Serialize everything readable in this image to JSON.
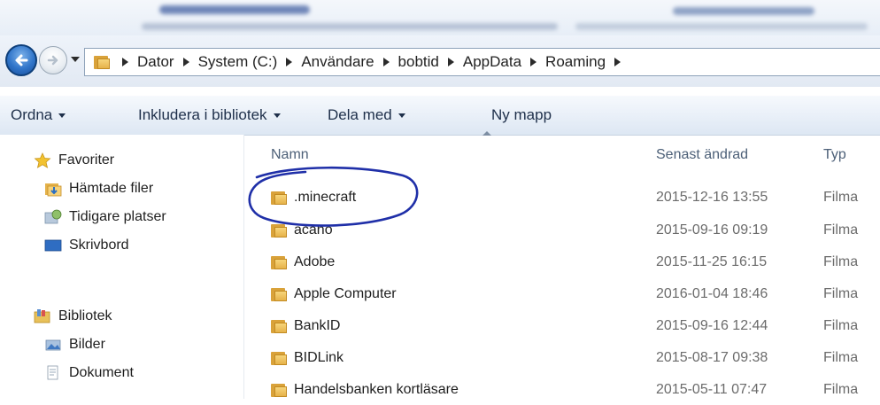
{
  "address": {
    "crumbs": [
      "Dator",
      "System (C:)",
      "Användare",
      "bobtid",
      "AppData",
      "Roaming"
    ]
  },
  "toolbar": {
    "organize": "Ordna",
    "include_in_library": "Inkludera i bibliotek",
    "share_with": "Dela med",
    "new_folder": "Ny mapp"
  },
  "navpane": {
    "favorites": "Favoriter",
    "downloads": "Hämtade filer",
    "recent_places": "Tidigare platser",
    "desktop": "Skrivbord",
    "libraries": "Bibliotek",
    "pictures": "Bilder",
    "documents": "Dokument"
  },
  "columns": {
    "name": "Namn",
    "date_modified": "Senast ändrad",
    "type": "Typ"
  },
  "files": [
    {
      "name": ".minecraft",
      "date": "2015-12-16 13:55",
      "type": "Filma"
    },
    {
      "name": "acano",
      "date": "2015-09-16 09:19",
      "type": "Filma"
    },
    {
      "name": "Adobe",
      "date": "2015-11-25 16:15",
      "type": "Filma"
    },
    {
      "name": "Apple Computer",
      "date": "2016-01-04 18:46",
      "type": "Filma"
    },
    {
      "name": "BankID",
      "date": "2015-09-16 12:44",
      "type": "Filma"
    },
    {
      "name": "BIDLink",
      "date": "2015-08-17 09:38",
      "type": "Filma"
    },
    {
      "name": "Handelsbanken kortläsare",
      "date": "2015-05-11 07:47",
      "type": "Filma"
    }
  ],
  "annotation": {
    "color": "#1f2fa8",
    "target": ".minecraft"
  }
}
